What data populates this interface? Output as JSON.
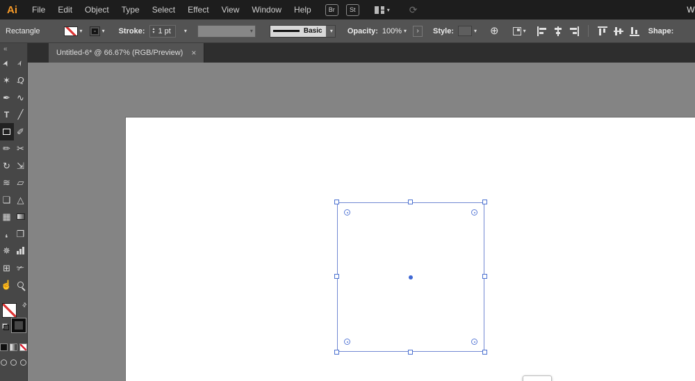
{
  "menubar": {
    "logo": "Ai",
    "menus": [
      {
        "name": "menu-file",
        "label": "File"
      },
      {
        "name": "menu-edit",
        "label": "Edit"
      },
      {
        "name": "menu-object",
        "label": "Object"
      },
      {
        "name": "menu-type",
        "label": "Type"
      },
      {
        "name": "menu-select",
        "label": "Select"
      },
      {
        "name": "menu-effect",
        "label": "Effect"
      },
      {
        "name": "menu-view",
        "label": "View"
      },
      {
        "name": "menu-window",
        "label": "Window"
      },
      {
        "name": "menu-help",
        "label": "Help"
      }
    ],
    "bridge_label": "Br",
    "stock_label": "St",
    "right_text": "We"
  },
  "controlbar": {
    "context_label": "Rectangle",
    "stroke_label": "Stroke:",
    "stroke_value": "1 pt",
    "brush_name": "Basic",
    "opacity_label": "Opacity:",
    "opacity_value": "100%",
    "opacity_more": "›",
    "style_label": "Style:",
    "shape_label": "Shape:"
  },
  "tabbar": {
    "tab_title": "Untitled-6* @ 66.67% (RGB/Preview)"
  },
  "tools": [
    {
      "name": "selection-tool",
      "glyph": "➤",
      "cls": "g-rot-65"
    },
    {
      "name": "direct-selection-tool",
      "glyph": "➢",
      "cls": "g-rot-65"
    },
    {
      "name": "magic-wand-tool",
      "glyph": "✶"
    },
    {
      "name": "lasso-tool",
      "glyph": "Ω",
      "cls": "g-rot15"
    },
    {
      "name": "pen-tool",
      "glyph": "✒"
    },
    {
      "name": "curvature-tool",
      "glyph": "∿"
    },
    {
      "name": "type-tool",
      "glyph": "T",
      "cls": "g-bold"
    },
    {
      "name": "line-segment-tool",
      "glyph": "╱"
    },
    {
      "name": "rectangle-tool",
      "glyph": "",
      "cls": "g-rect",
      "selected": true
    },
    {
      "name": "paintbrush-tool",
      "glyph": "✐"
    },
    {
      "name": "pencil-tool",
      "glyph": "✏"
    },
    {
      "name": "scissors-tool",
      "glyph": "✂"
    },
    {
      "name": "rotate-tool",
      "glyph": "↻"
    },
    {
      "name": "scale-tool",
      "glyph": "⇲"
    },
    {
      "name": "width-tool",
      "glyph": "≋"
    },
    {
      "name": "free-transform-tool",
      "glyph": "▱"
    },
    {
      "name": "shape-builder-tool",
      "glyph": "❏"
    },
    {
      "name": "perspective-grid-tool",
      "glyph": "△"
    },
    {
      "name": "mesh-tool",
      "glyph": "▦"
    },
    {
      "name": "gradient-tool",
      "glyph": "",
      "cls": "g-grad"
    },
    {
      "name": "eyedropper-tool",
      "glyph": "❜",
      "cls": "g-rot180"
    },
    {
      "name": "blend-tool",
      "glyph": "❐"
    },
    {
      "name": "symbol-sprayer-tool",
      "glyph": "✵"
    },
    {
      "name": "column-graph-tool",
      "glyph": "",
      "cls": "g-bars"
    },
    {
      "name": "artboard-tool",
      "glyph": "⊞"
    },
    {
      "name": "slice-tool",
      "glyph": "✃"
    },
    {
      "name": "hand-tool",
      "glyph": "☝"
    },
    {
      "name": "zoom-tool",
      "glyph": "",
      "cls": "g-zoom"
    }
  ],
  "icons": {
    "caret": "▾",
    "spinner_up": "▴",
    "spinner_down": "▾",
    "globe": "⊕",
    "sync": "⟳",
    "swap": "⇄",
    "collapse": "«",
    "close": "×"
  },
  "align_icons": [
    "horizontal-align-left",
    "horizontal-align-center",
    "horizontal-align-right",
    "vertical-align-top",
    "vertical-align-center",
    "vertical-align-bottom"
  ],
  "colors": {
    "selection_blue": "#4a70d0",
    "selection_stroke": "#7087d2",
    "none_red": "#dc3434",
    "logo_orange": "#f79a28",
    "canvas_gray": "#848484"
  }
}
